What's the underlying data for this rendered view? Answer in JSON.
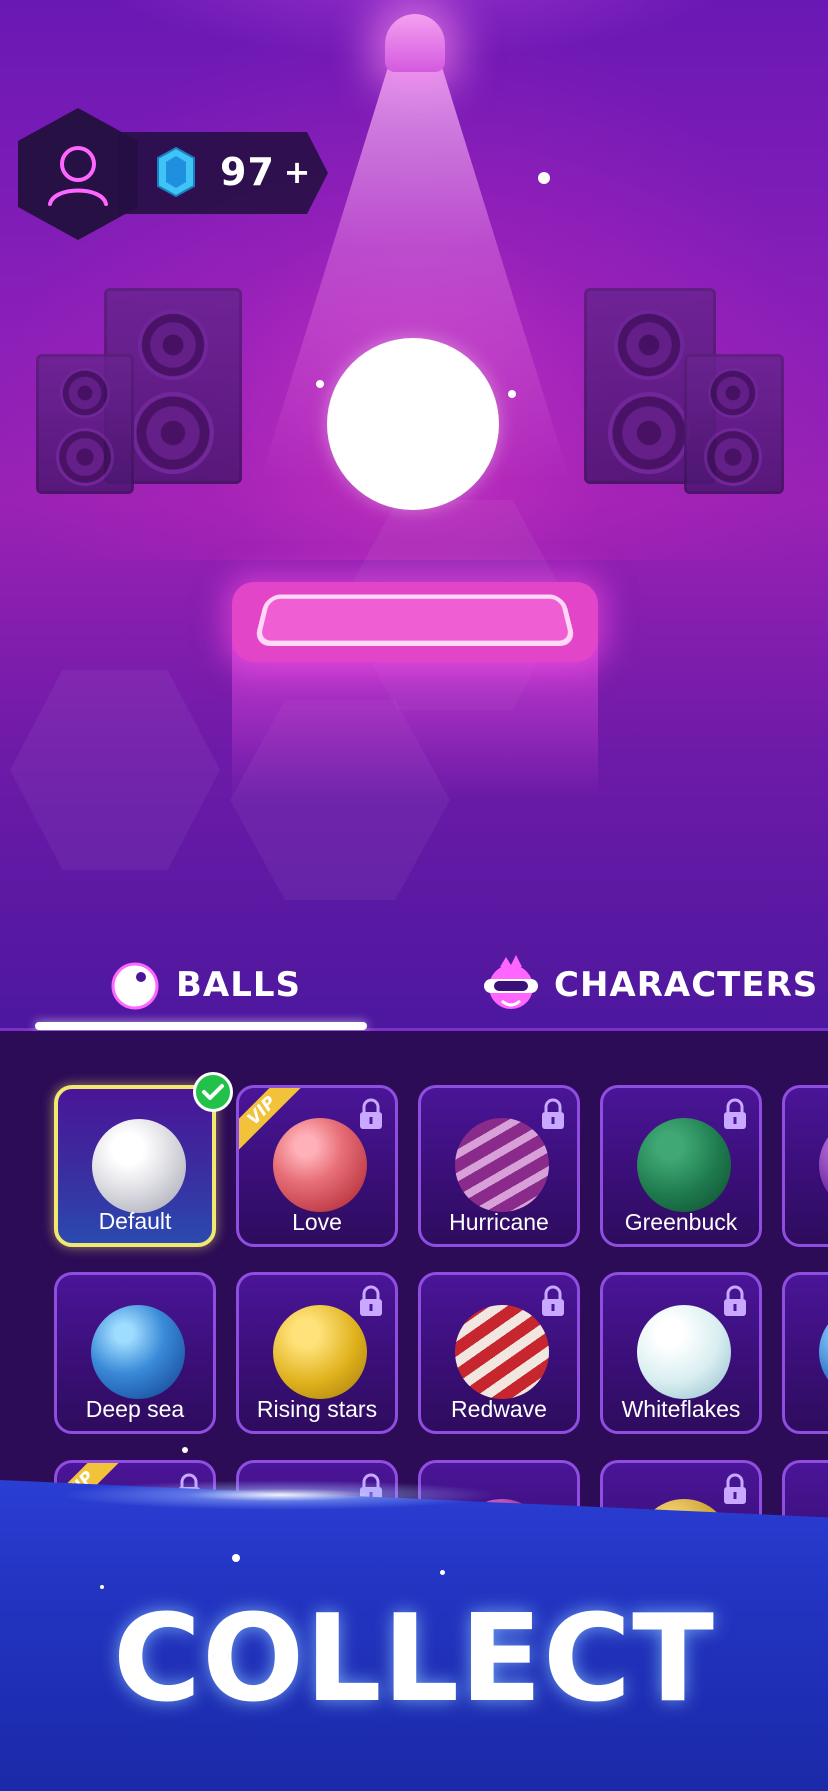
{
  "currency": {
    "gems": "97",
    "add_label": "+"
  },
  "tabs": [
    {
      "label": "BALLS",
      "active": true
    },
    {
      "label": "CHARACTERS",
      "active": false
    }
  ],
  "balls": [
    {
      "name": "Default",
      "selected": true,
      "locked": false,
      "vip": false
    },
    {
      "name": "Love",
      "selected": false,
      "locked": true,
      "vip": true
    },
    {
      "name": "Hurricane",
      "selected": false,
      "locked": true,
      "vip": false
    },
    {
      "name": "Greenbuck",
      "selected": false,
      "locked": true,
      "vip": false
    },
    {
      "name": "Deep sea",
      "selected": false,
      "locked": false,
      "vip": false
    },
    {
      "name": "Rising stars",
      "selected": false,
      "locked": true,
      "vip": false
    },
    {
      "name": "Redwave",
      "selected": false,
      "locked": true,
      "vip": false
    },
    {
      "name": "Whiteflakes",
      "selected": false,
      "locked": true,
      "vip": false
    }
  ],
  "vip_label": "VIP",
  "banner": {
    "title": "COLLECT"
  },
  "colors": {
    "accent": "#e245c8",
    "selected_border": "#f0e870",
    "check": "#22c24a",
    "banner": "#2233c0"
  }
}
